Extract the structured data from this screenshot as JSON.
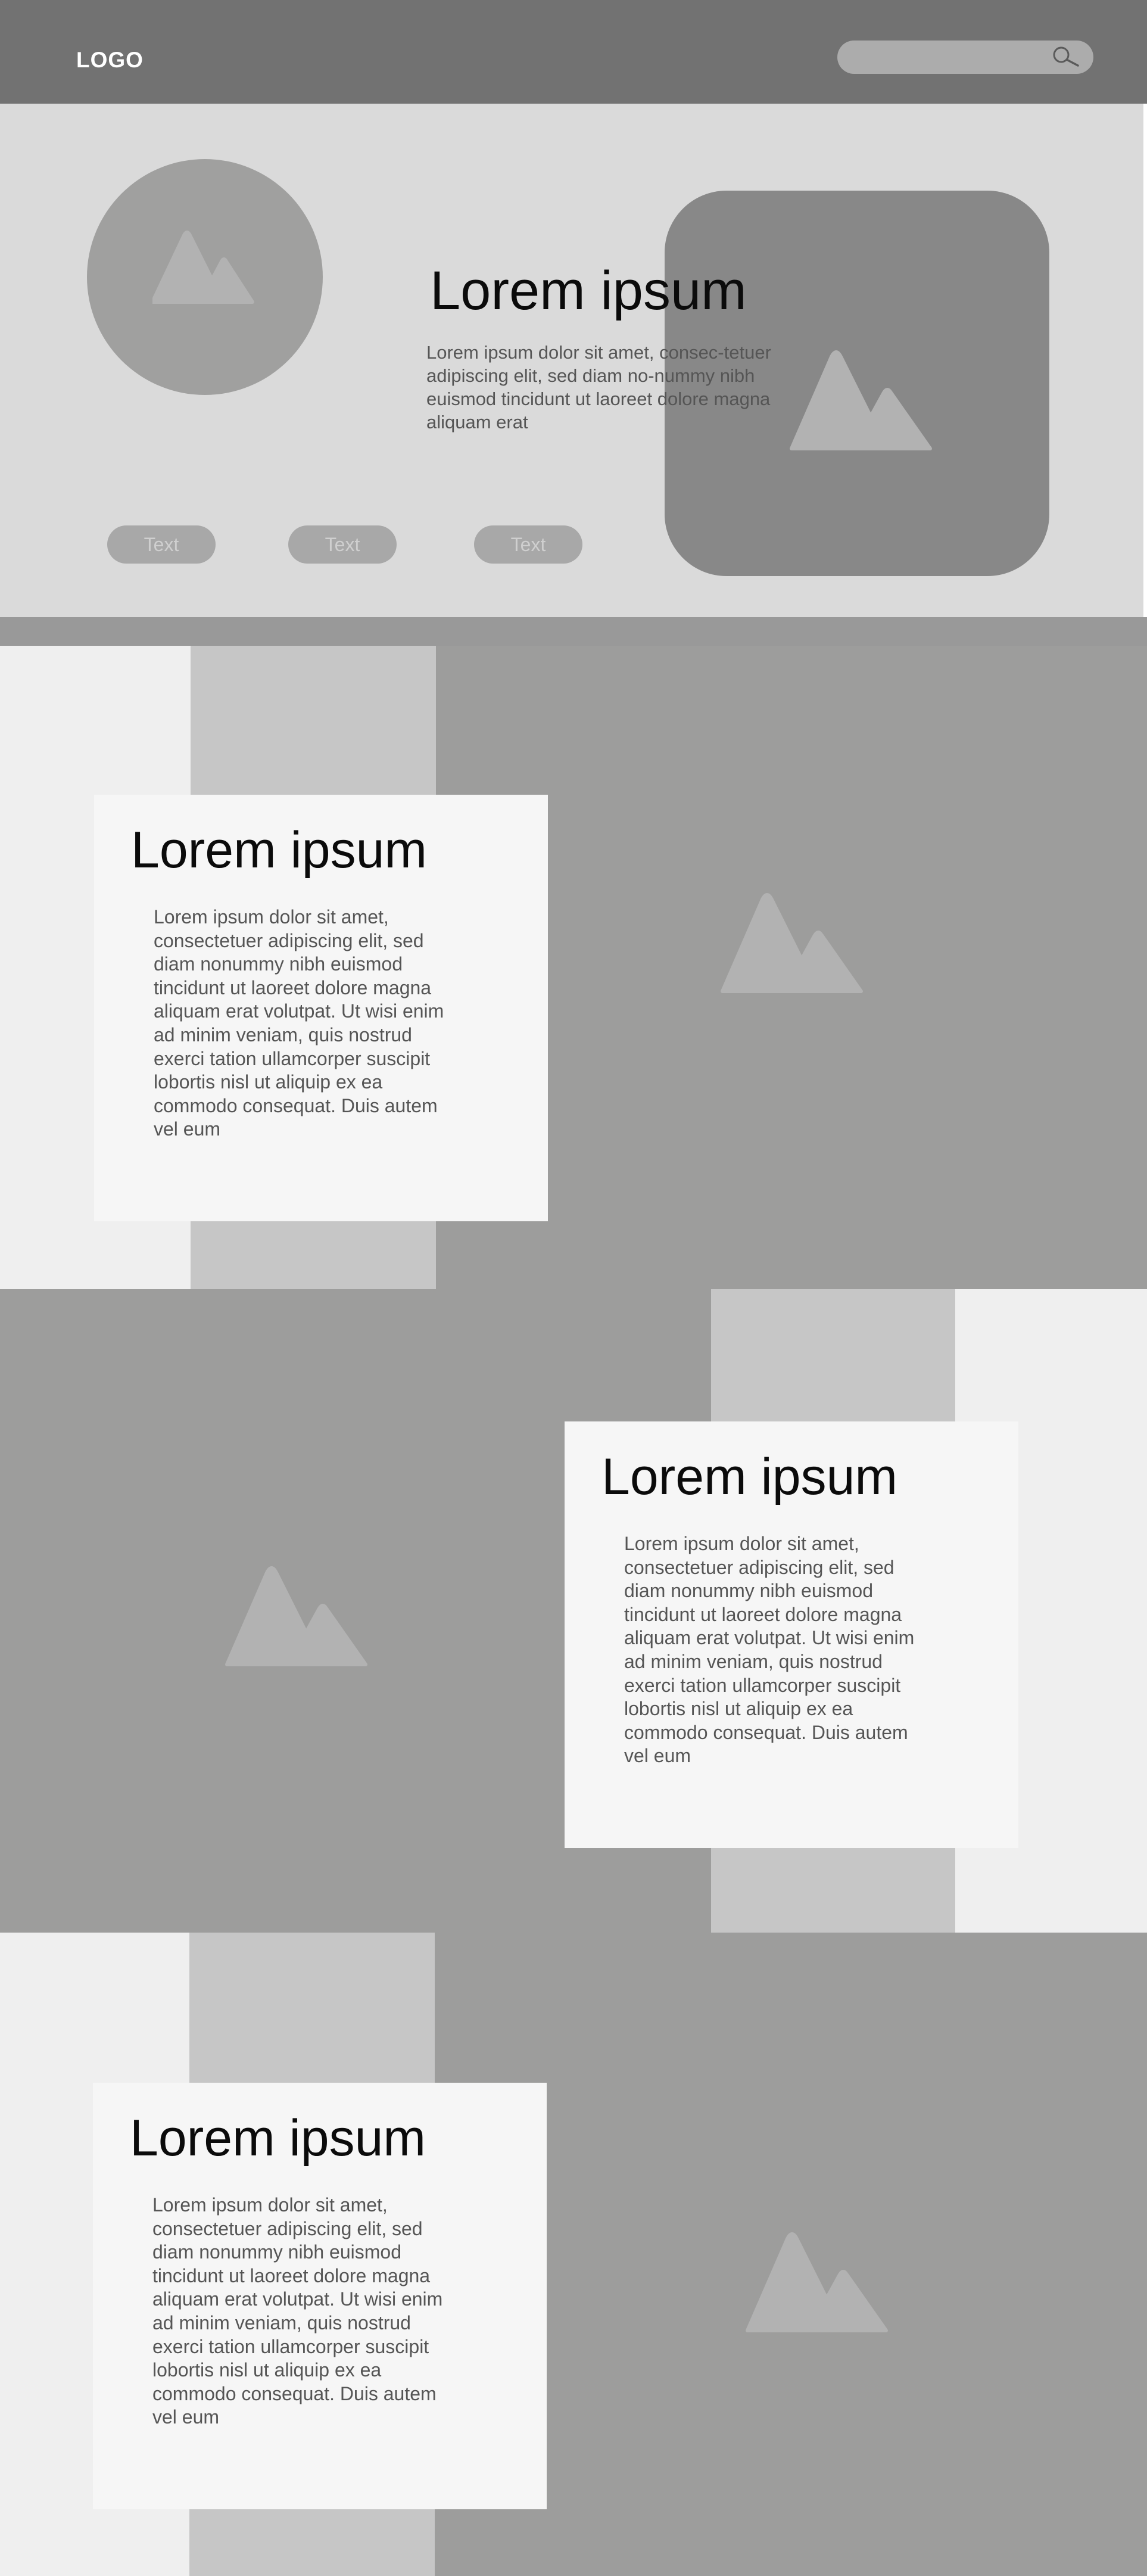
{
  "header": {
    "logo": "LOGO",
    "search_icon": "magnifier-icon"
  },
  "hero": {
    "title": "Lorem ipsum",
    "body": "Lorem ipsum dolor sit amet, consec-tetuer adipiscing elit, sed diam no-nummy nibh euismod tincidunt ut laoreet dolore magna aliquam erat",
    "buttons": [
      "Text",
      "Text",
      "Text"
    ]
  },
  "sections": [
    {
      "title": "Lorem ipsum",
      "body": "Lorem ipsum dolor sit amet, consectetuer adipiscing elit, sed diam nonummy nibh euismod tincidunt ut laoreet dolore magna aliquam erat volutpat. Ut wisi enim ad minim veniam, quis nostrud exerci tation ullamcorper suscipit lobortis nisl ut aliquip ex ea commodo consequat. Duis autem vel eum"
    },
    {
      "title": "Lorem ipsum",
      "body": "Lorem ipsum dolor sit amet, consectetuer adipiscing elit, sed diam nonummy nibh euismod tincidunt ut laoreet dolore magna aliquam erat volutpat. Ut wisi enim ad minim veniam, quis nostrud exerci tation ullamcorper suscipit lobortis nisl ut aliquip ex ea commodo consequat. Duis autem vel eum"
    },
    {
      "title": "Lorem ipsum",
      "body": "Lorem ipsum dolor sit amet, consectetuer adipiscing elit, sed diam nonummy nibh euismod tincidunt ut laoreet dolore magna aliquam erat volutpat. Ut wisi enim ad minim veniam, quis nostrud exerci tation ullamcorper suscipit lobortis nisl ut aliquip ex ea commodo consequat. Duis autem vel eum"
    }
  ],
  "colors": {
    "header_bg": "#727272",
    "hero_bg": "#dadada",
    "image_placeholder": "#9d9d9c",
    "card_bg": "#f6f6f6",
    "mountain_icon": "#b2b2b2"
  },
  "icons": {
    "image_placeholder": "mountain-icon"
  }
}
